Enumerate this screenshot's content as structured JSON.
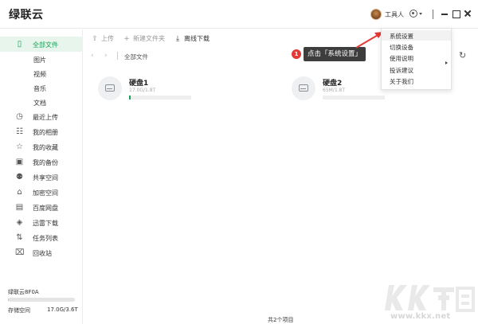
{
  "app": {
    "title": "绿联云"
  },
  "header": {
    "username": "工具人"
  },
  "sidebar": {
    "items": [
      {
        "label": "全部文件",
        "icon": "file-icon",
        "glyph": "▯"
      },
      {
        "label": "最近上传",
        "icon": "clock-icon",
        "glyph": "◷"
      },
      {
        "label": "我的相册",
        "icon": "album-icon",
        "glyph": "☷"
      },
      {
        "label": "我的收藏",
        "icon": "star-icon",
        "glyph": "☆"
      },
      {
        "label": "我的备份",
        "icon": "backup-icon",
        "glyph": "▣"
      },
      {
        "label": "共享空间",
        "icon": "users-icon",
        "glyph": "⚉"
      },
      {
        "label": "加密空间",
        "icon": "lock-icon",
        "glyph": "⌂"
      },
      {
        "label": "百度网盘",
        "icon": "baidu-icon",
        "glyph": "▤"
      },
      {
        "label": "迅雷下载",
        "icon": "thunder-icon",
        "glyph": "◈"
      },
      {
        "label": "任务列表",
        "icon": "transfer-icon",
        "glyph": "⇅"
      },
      {
        "label": "回收站",
        "icon": "trash-icon",
        "glyph": "⌧"
      }
    ],
    "subitems": [
      "图片",
      "视频",
      "音乐",
      "文档"
    ],
    "storage": {
      "name": "绿联云8F0A",
      "label": "存储空间",
      "value": "17.0G/3.6T",
      "used_fraction": 0.005
    }
  },
  "toolbar": {
    "upload": "上传",
    "new_folder": "新建文件夹",
    "offline_download": "离线下载"
  },
  "nav": {
    "breadcrumb": "全部文件"
  },
  "disks": [
    {
      "name": "硬盘1",
      "usage": "17.0G/1.8T",
      "used_fraction": 0.01
    },
    {
      "name": "硬盘2",
      "usage": "65M/1.8T",
      "used_fraction": 0.0
    }
  ],
  "menu": {
    "items": [
      "系统设置",
      "切换设备",
      "使用说明",
      "投诉建议",
      "关于我们"
    ]
  },
  "annotation": {
    "badge": "1",
    "text": "点击「系统设置」"
  },
  "status": {
    "text": "共2个项目"
  },
  "watermark": {
    "url": "www.kkx.net"
  },
  "colors": {
    "accent": "#18a058",
    "badge": "#e53935",
    "tooltip": "#3d3d3d",
    "arrow": "#e53935"
  }
}
